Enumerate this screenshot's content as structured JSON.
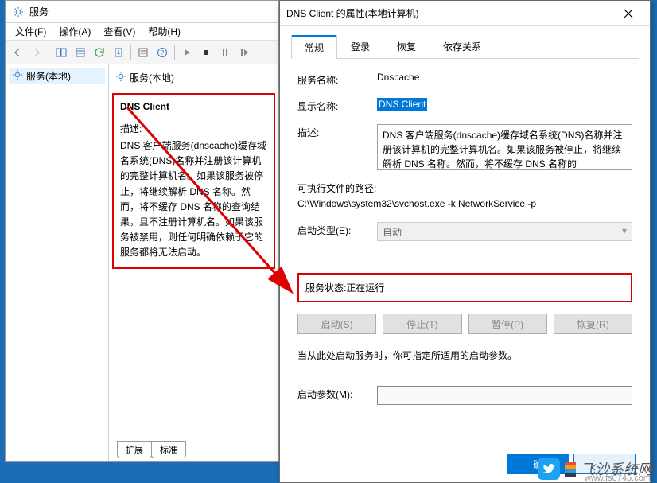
{
  "services": {
    "title": "服务",
    "menu": {
      "file": "文件(F)",
      "action": "操作(A)",
      "view": "查看(V)",
      "help": "帮助(H)"
    },
    "tree_item": "服务(本地)",
    "panel_header": "服务(本地)",
    "detail": {
      "name": "DNS Client",
      "desc_label": "描述:",
      "desc": "DNS 客户端服务(dnscache)缓存域名系统(DNS)名称并注册该计算机的完整计算机名。如果该服务被停止，将继续解析 DNS 名称。然而，将不缓存 DNS 名称的查询结果，且不注册计算机名。如果该服务被禁用，则任何明确依赖于它的服务都将无法启动。"
    },
    "tabs_bottom": {
      "extended": "扩展",
      "standard": "标准"
    }
  },
  "props": {
    "title": "DNS Client 的属性(本地计算机)",
    "tabs": {
      "general": "常规",
      "logon": "登录",
      "recovery": "恢复",
      "deps": "依存关系"
    },
    "fields": {
      "service_name_lbl": "服务名称:",
      "service_name": "Dnscache",
      "display_name_lbl": "显示名称:",
      "display_name": "DNS Client",
      "desc_lbl": "描述:",
      "desc": "DNS 客户端服务(dnscache)缓存域名系统(DNS)名称并注册该计算机的完整计算机名。如果该服务被停止，将继续解析 DNS 名称。然而，将不缓存 DNS 名称的",
      "exe_lbl": "可执行文件的路径:",
      "exe_path": "C:\\Windows\\system32\\svchost.exe -k NetworkService -p",
      "startup_lbl": "启动类型(E):",
      "startup_val": "自动",
      "status_lbl": "服务状态:",
      "status_val": "正在运行",
      "note": "当从此处启动服务时，你可指定所适用的启动参数。",
      "params_lbl": "启动参数(M):"
    },
    "buttons": {
      "start": "启动(S)",
      "stop": "停止(T)",
      "pause": "暂停(P)",
      "resume": "恢复(R)",
      "ok": "确",
      "cancel": ""
    }
  },
  "watermark": {
    "brand": "飞沙系统网",
    "url": "www.fs0745.com"
  }
}
